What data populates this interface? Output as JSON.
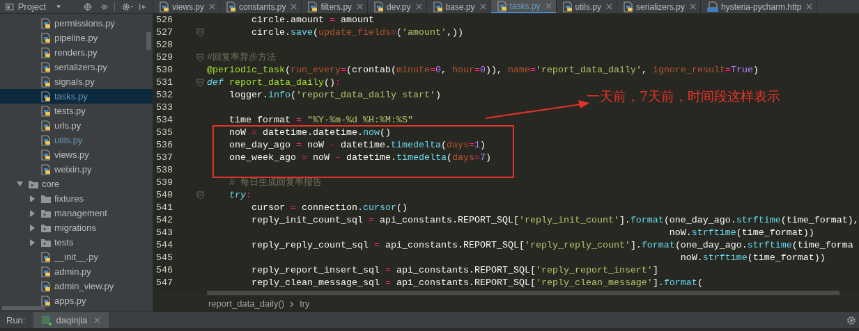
{
  "sidebar": {
    "title": "Project",
    "tree": [
      {
        "kind": "continued",
        "children": [
          {
            "kind": "python",
            "label": "permissions.py",
            "selected": false,
            "modified": false
          },
          {
            "kind": "python",
            "label": "pipeline.py",
            "selected": false,
            "modified": false
          },
          {
            "kind": "python",
            "label": "renders.py",
            "selected": false,
            "modified": false
          },
          {
            "kind": "python",
            "label": "serializers.py",
            "selected": false,
            "modified": false
          },
          {
            "kind": "python",
            "label": "signals.py",
            "selected": false,
            "modified": false
          },
          {
            "kind": "python",
            "label": "tasks.py",
            "selected": true,
            "modified": true
          },
          {
            "kind": "python",
            "label": "tests.py",
            "selected": false,
            "modified": false
          },
          {
            "kind": "python",
            "label": "urls.py",
            "selected": false,
            "modified": false
          },
          {
            "kind": "python",
            "label": "utils.py",
            "selected": false,
            "modified": true
          },
          {
            "kind": "python",
            "label": "views.py",
            "selected": false,
            "modified": false
          },
          {
            "kind": "python",
            "label": "weixin.py",
            "selected": false,
            "modified": false
          }
        ]
      },
      {
        "kind": "package",
        "label": "core",
        "expanded": true,
        "selected": false,
        "modified": false,
        "children": [
          {
            "kind": "folder",
            "label": "fixtures",
            "expanded": false,
            "selected": false,
            "modified": false
          },
          {
            "kind": "package",
            "label": "management",
            "expanded": false,
            "selected": false,
            "modified": false
          },
          {
            "kind": "package",
            "label": "migrations",
            "expanded": false,
            "selected": false,
            "modified": false
          },
          {
            "kind": "package",
            "label": "tests",
            "expanded": false,
            "selected": false,
            "modified": false
          },
          {
            "kind": "python",
            "label": "__init__.py",
            "selected": false,
            "modified": false
          },
          {
            "kind": "python",
            "label": "admin.py",
            "selected": false,
            "modified": false
          },
          {
            "kind": "python",
            "label": "admin_view.py",
            "selected": false,
            "modified": false
          },
          {
            "kind": "python",
            "label": "apps.py",
            "selected": false,
            "modified": false
          }
        ]
      }
    ]
  },
  "tabs": [
    {
      "kind": "python",
      "label": "views.py",
      "selected": false
    },
    {
      "kind": "python",
      "label": "constants.py",
      "selected": false
    },
    {
      "kind": "python",
      "label": "filters.py",
      "selected": false
    },
    {
      "kind": "python",
      "label": "dev.py",
      "selected": false
    },
    {
      "kind": "python",
      "label": "base.py",
      "selected": false
    },
    {
      "kind": "python",
      "label": "tasks.py",
      "selected": true
    },
    {
      "kind": "python",
      "label": "utils.py",
      "selected": false
    },
    {
      "kind": "python",
      "label": "serializers.py",
      "selected": false
    },
    {
      "kind": "http",
      "label": "hysteria-pycharm.http",
      "selected": false
    }
  ],
  "editor": {
    "annotation": "一天前，7天前，时间段这样表示",
    "lines": [
      {
        "number": "526",
        "tokens": [
          {
            "kind": "plain",
            "text": "        circle.amount "
          },
          {
            "kind": "op",
            "text": "="
          },
          {
            "kind": "plain",
            "text": " amount"
          }
        ]
      },
      {
        "number": "527",
        "fold": true,
        "tokens": [
          {
            "kind": "plain",
            "text": "        circle."
          },
          {
            "kind": "method",
            "text": "save"
          },
          {
            "kind": "plain",
            "text": "("
          },
          {
            "kind": "param",
            "text": "update_fields"
          },
          {
            "kind": "op",
            "text": "="
          },
          {
            "kind": "plain",
            "text": "("
          },
          {
            "kind": "string",
            "text": "'amount'"
          },
          {
            "kind": "plain",
            "text": ",))"
          }
        ]
      },
      {
        "number": "528"
      },
      {
        "number": "529",
        "fold": true,
        "tokens": [
          {
            "kind": "comment",
            "text": "#回复率异步方法"
          }
        ]
      },
      {
        "number": "530",
        "tokens": [
          {
            "kind": "decorator",
            "text": "@periodic_task"
          },
          {
            "kind": "plain",
            "text": "("
          },
          {
            "kind": "param",
            "text": "run_every"
          },
          {
            "kind": "op",
            "text": "="
          },
          {
            "kind": "plain",
            "text": "(crontab("
          },
          {
            "kind": "param",
            "text": "minute"
          },
          {
            "kind": "op",
            "text": "="
          },
          {
            "kind": "number",
            "text": "0"
          },
          {
            "kind": "plain",
            "text": ", "
          },
          {
            "kind": "param",
            "text": "hour"
          },
          {
            "kind": "op",
            "text": "="
          },
          {
            "kind": "number",
            "text": "0"
          },
          {
            "kind": "plain",
            "text": ")), "
          },
          {
            "kind": "param",
            "text": "name"
          },
          {
            "kind": "op",
            "text": "="
          },
          {
            "kind": "string",
            "text": "'report_data_daily'"
          },
          {
            "kind": "plain",
            "text": ", "
          },
          {
            "kind": "param",
            "text": "ignore_result"
          },
          {
            "kind": "op",
            "text": "="
          },
          {
            "kind": "number",
            "text": "True"
          },
          {
            "kind": "plain",
            "text": ")"
          }
        ]
      },
      {
        "number": "531",
        "fold": true,
        "tokens": [
          {
            "kind": "keyword",
            "text": "def"
          },
          {
            "kind": "function",
            "text": " report_data_daily"
          },
          {
            "kind": "plain",
            "text": "()"
          },
          {
            "kind": "op",
            "text": ":"
          }
        ]
      },
      {
        "number": "532",
        "tokens": [
          {
            "kind": "plain",
            "text": "    logger."
          },
          {
            "kind": "method",
            "text": "info"
          },
          {
            "kind": "plain",
            "text": "("
          },
          {
            "kind": "string",
            "text": "'report_data_daily start'"
          },
          {
            "kind": "plain",
            "text": ")"
          }
        ]
      },
      {
        "number": "533"
      },
      {
        "number": "534",
        "tokens": [
          {
            "kind": "plain",
            "text": "    time format "
          },
          {
            "kind": "op",
            "text": "="
          },
          {
            "kind": "string",
            "text": " \"%Y-%m-%d %H:%M:%S\""
          }
        ]
      },
      {
        "number": "535",
        "tokens": [
          {
            "kind": "plain",
            "text": "    noW "
          },
          {
            "kind": "op",
            "text": "="
          },
          {
            "kind": "plain",
            "text": " datetime.datetime."
          },
          {
            "kind": "method",
            "text": "now"
          },
          {
            "kind": "plain",
            "text": "()"
          }
        ]
      },
      {
        "number": "536",
        "tokens": [
          {
            "kind": "plain",
            "text": "    one_day_ago "
          },
          {
            "kind": "op",
            "text": "="
          },
          {
            "kind": "plain",
            "text": " noW "
          },
          {
            "kind": "op",
            "text": "-"
          },
          {
            "kind": "plain",
            "text": " datetime."
          },
          {
            "kind": "method",
            "text": "timedelta"
          },
          {
            "kind": "plain",
            "text": "("
          },
          {
            "kind": "param",
            "text": "days"
          },
          {
            "kind": "op",
            "text": "="
          },
          {
            "kind": "number",
            "text": "1"
          },
          {
            "kind": "plain",
            "text": ")"
          }
        ]
      },
      {
        "number": "537",
        "tokens": [
          {
            "kind": "plain",
            "text": "    one_week_ago "
          },
          {
            "kind": "op",
            "text": "="
          },
          {
            "kind": "plain",
            "text": " noW "
          },
          {
            "kind": "op",
            "text": "-"
          },
          {
            "kind": "plain",
            "text": " datetime."
          },
          {
            "kind": "method",
            "text": "timedelta"
          },
          {
            "kind": "plain",
            "text": "("
          },
          {
            "kind": "param",
            "text": "days"
          },
          {
            "kind": "op",
            "text": "="
          },
          {
            "kind": "number",
            "text": "7"
          },
          {
            "kind": "plain",
            "text": ")"
          }
        ]
      },
      {
        "number": "538"
      },
      {
        "number": "539",
        "tokens": [
          {
            "kind": "comment",
            "text": "    # 每日生成回复率报告"
          }
        ]
      },
      {
        "number": "540",
        "fold": true,
        "tokens": [
          {
            "kind": "keyword",
            "text": "    try"
          },
          {
            "kind": "op",
            "text": ":"
          }
        ]
      },
      {
        "number": "541",
        "tokens": [
          {
            "kind": "plain",
            "text": "        cursor "
          },
          {
            "kind": "op",
            "text": "="
          },
          {
            "kind": "plain",
            "text": " connection."
          },
          {
            "kind": "method",
            "text": "cursor"
          },
          {
            "kind": "plain",
            "text": "()"
          }
        ]
      },
      {
        "number": "542",
        "tokens": [
          {
            "kind": "plain",
            "text": "        reply_init_count_sql "
          },
          {
            "kind": "op",
            "text": "="
          },
          {
            "kind": "plain",
            "text": " api_constants.REPORT_SQL["
          },
          {
            "kind": "string",
            "text": "'reply_init_count'"
          },
          {
            "kind": "plain",
            "text": "]."
          },
          {
            "kind": "method",
            "text": "format"
          },
          {
            "kind": "plain",
            "text": "(one_day_ago."
          },
          {
            "kind": "method",
            "text": "strftime"
          },
          {
            "kind": "plain",
            "text": "(time_format),"
          }
        ]
      },
      {
        "number": "543",
        "tokens": [
          {
            "kind": "plain",
            "text": "                                                                                   noW."
          },
          {
            "kind": "method",
            "text": "strftime"
          },
          {
            "kind": "plain",
            "text": "(time_format))"
          }
        ]
      },
      {
        "number": "544",
        "tokens": [
          {
            "kind": "plain",
            "text": "        reply_reply_count_sql "
          },
          {
            "kind": "op",
            "text": "="
          },
          {
            "kind": "plain",
            "text": " api_constants.REPORT_SQL["
          },
          {
            "kind": "string",
            "text": "'reply_reply_count'"
          },
          {
            "kind": "plain",
            "text": "]."
          },
          {
            "kind": "method",
            "text": "format"
          },
          {
            "kind": "plain",
            "text": "(one_day_ago."
          },
          {
            "kind": "method",
            "text": "strftime"
          },
          {
            "kind": "plain",
            "text": "(time_forma"
          }
        ]
      },
      {
        "number": "545",
        "tokens": [
          {
            "kind": "plain",
            "text": "                                                                                     noW."
          },
          {
            "kind": "method",
            "text": "strftime"
          },
          {
            "kind": "plain",
            "text": "(time_format))"
          }
        ]
      },
      {
        "number": "546",
        "tokens": [
          {
            "kind": "plain",
            "text": "        reply_report_insert_sql "
          },
          {
            "kind": "op",
            "text": "="
          },
          {
            "kind": "plain",
            "text": " api_constants.REPORT_SQL["
          },
          {
            "kind": "string",
            "text": "'reply_report_insert'"
          },
          {
            "kind": "plain",
            "text": "]"
          }
        ]
      },
      {
        "number": "547",
        "tokens": [
          {
            "kind": "plain",
            "text": "        reply_clean_message_sql "
          },
          {
            "kind": "op",
            "text": "="
          },
          {
            "kind": "plain",
            "text": " api_constants.REPORT_SQL["
          },
          {
            "kind": "string",
            "text": "'reply_clean_message'"
          },
          {
            "kind": "plain",
            "text": "]."
          },
          {
            "kind": "method",
            "text": "format"
          },
          {
            "kind": "plain",
            "text": "("
          }
        ]
      }
    ]
  },
  "breadcrumbs": [
    "report_data_daily()",
    "try"
  ],
  "run_bar": {
    "label": "Run:",
    "tabs": [
      {
        "label": "daqinjia"
      }
    ]
  }
}
